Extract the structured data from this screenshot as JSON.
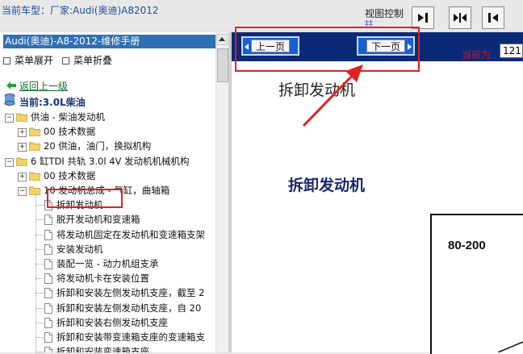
{
  "header": {
    "vehicle_text": "当前车型：厂家:Audi(奥迪)A82012",
    "view_control_label": "视图控制",
    "handle_glyph": "‡‡"
  },
  "view_buttons": [
    {
      "name": "collapse-left-icon"
    },
    {
      "name": "split-view-icon"
    },
    {
      "name": "expand-right-icon"
    }
  ],
  "sidebar": {
    "title": "Audi(奥迪)-A8-2012-维修手册",
    "expand_menu": "菜单展开",
    "collapse_menu": "菜单折叠",
    "back_link": "返回上一级",
    "current": "当前:3.0L柴油",
    "tree": [
      {
        "label": "供油 - 柴油发动机",
        "kind": "folder",
        "level": 0,
        "expander": "−"
      },
      {
        "label": "00 技术数据",
        "kind": "folder",
        "level": 1,
        "expander": "+"
      },
      {
        "label": "20 供油，油门，换拟机构",
        "kind": "folder",
        "level": 1,
        "expander": "+"
      },
      {
        "label": "6 缸TDI 共轨 3.0l 4V 发动机机械机构",
        "kind": "folder",
        "level": 0,
        "expander": "−"
      },
      {
        "label": "00 技术数据",
        "kind": "folder",
        "level": 1,
        "expander": "+"
      },
      {
        "label": "10 发动机总成 - 气缸，曲轴箱",
        "kind": "folder",
        "level": 1,
        "expander": "−"
      },
      {
        "label": "拆卸发动机",
        "kind": "doc",
        "level": 2,
        "selected": true
      },
      {
        "label": "脱开发动机和变速箱",
        "kind": "doc",
        "level": 2
      },
      {
        "label": "将发动机固定在发动机和变速箱支架",
        "kind": "doc",
        "level": 2
      },
      {
        "label": "安装发动机",
        "kind": "doc",
        "level": 2
      },
      {
        "label": "装配一览 - 动力机组支承",
        "kind": "doc",
        "level": 2
      },
      {
        "label": "将发动机卡在安装位置",
        "kind": "doc",
        "level": 2
      },
      {
        "label": "拆卸和安装左侧发动机支座，截至 2",
        "kind": "doc",
        "level": 2
      },
      {
        "label": "拆卸和安装左侧发动机支座，自 20",
        "kind": "doc",
        "level": 2
      },
      {
        "label": "拆卸和安装右侧发动机支座",
        "kind": "doc",
        "level": 2
      },
      {
        "label": "拆卸和安装带变速箱支座的变速箱支",
        "kind": "doc",
        "level": 2
      },
      {
        "label": "拆卸和安装变速箱支座",
        "kind": "doc",
        "level": 2
      }
    ]
  },
  "nav": {
    "prev_label": "上一页",
    "next_label": "下一页",
    "current_page_label": "当前为",
    "page_value": "121"
  },
  "document": {
    "heading_small": "拆卸发动机",
    "heading_main": "拆卸发动机",
    "figure_label": "80-200"
  },
  "colors": {
    "nav_bar": "#0a2a78",
    "sidebar_title": "#2f6fb6",
    "annotation": "#e02020"
  }
}
